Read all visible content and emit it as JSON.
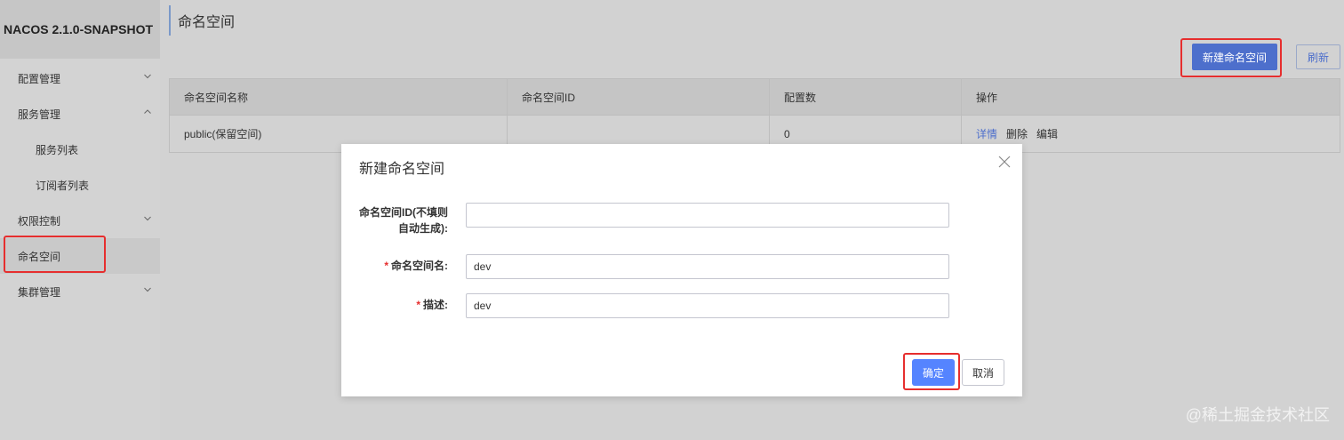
{
  "app": {
    "title": "NACOS 2.1.0-SNAPSHOT"
  },
  "sidebar": {
    "items": [
      {
        "label": "配置管理",
        "chevron": "chevron-down-icon"
      },
      {
        "label": "服务管理",
        "chevron": "chevron-up-icon"
      },
      {
        "label": "服务列表"
      },
      {
        "label": "订阅者列表"
      },
      {
        "label": "权限控制",
        "chevron": "chevron-down-icon"
      },
      {
        "label": "命名空间",
        "active": true
      },
      {
        "label": "集群管理",
        "chevron": "chevron-down-icon"
      }
    ]
  },
  "page": {
    "title": "命名空间",
    "new_button": "新建命名空间",
    "refresh_button": "刷新"
  },
  "table": {
    "headers": [
      "命名空间名称",
      "命名空间ID",
      "配置数",
      "操作"
    ],
    "rows": [
      {
        "name": "public(保留空间)",
        "id": "",
        "count": "0",
        "actions": [
          "详情",
          "删除",
          "编辑"
        ]
      }
    ]
  },
  "dialog": {
    "title": "新建命名空间",
    "id_label_line1": "命名空间ID(不填则",
    "id_label_line2": "自动生成):",
    "id_value": "",
    "name_label": "命名空间名:",
    "name_value": "dev",
    "desc_label": "描述:",
    "desc_value": "dev",
    "ok_button": "确定",
    "cancel_button": "取消",
    "required_mark": "*"
  },
  "watermark": "@稀土掘金技术社区",
  "colors": {
    "primary": "#4d6fcc",
    "ok": "#5584ff",
    "annotation": "#e62e2e"
  }
}
